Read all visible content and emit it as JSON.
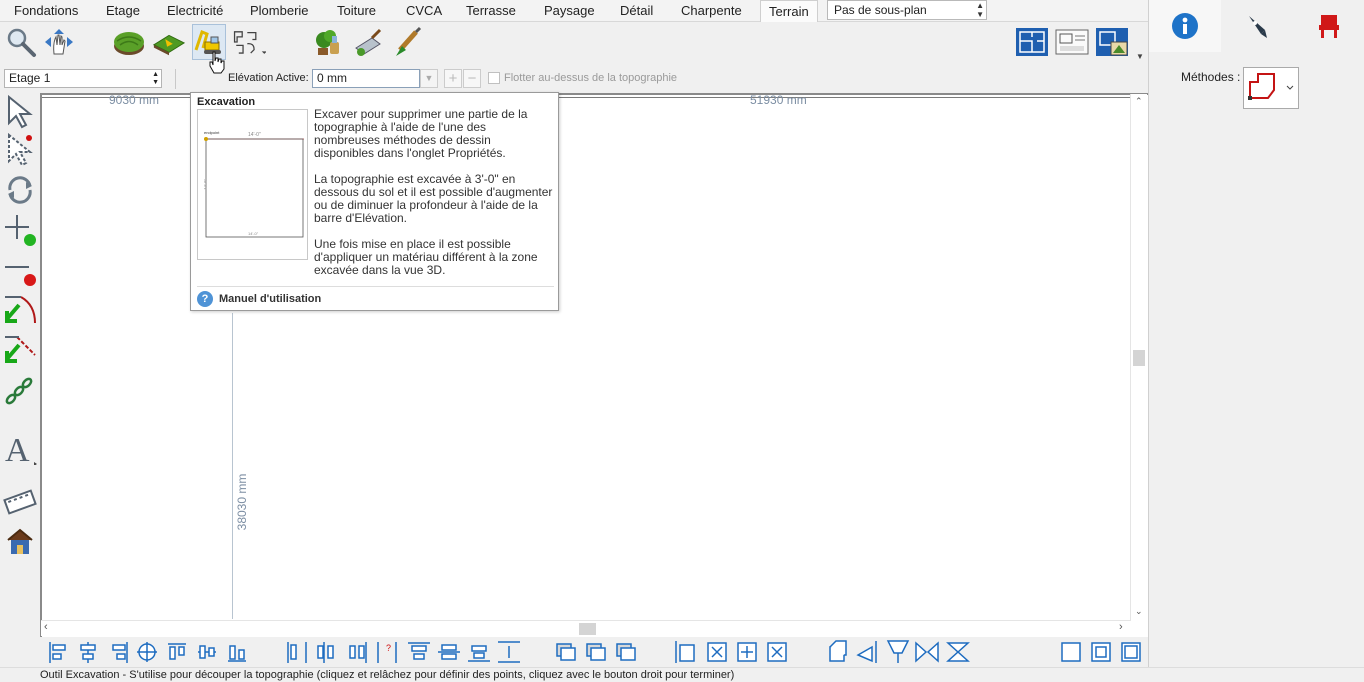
{
  "menu": {
    "tabs": [
      "Fondations",
      "Etage",
      "Electricité",
      "Plomberie",
      "Toiture",
      "CVCA",
      "Terrasse",
      "Paysage",
      "Détail",
      "Charpente",
      "Terrain"
    ],
    "active_tab": "Terrain",
    "subplan_value": "Pas de sous-plan"
  },
  "toolbar": {
    "tools": [
      "zoom-icon",
      "pan-icon",
      "terrain-hill-icon",
      "terrain-flat-icon",
      "excavation-icon",
      "outline-tools-icon",
      "plants-icon",
      "trowel-icon",
      "paint-brush-icon",
      "plan-view-icon",
      "sheet-view-icon",
      "3d-view-icon"
    ],
    "selected_tool": "excavation-icon"
  },
  "floorbar": {
    "floor_value": "Etage 1",
    "elevation_label": "Elévation Active:",
    "elevation_value": "0 mm",
    "float_label": "Flotter au-dessus de la topographie"
  },
  "canvas": {
    "dim_left_top": "9030 mm",
    "dim_right_top": "51930 mm",
    "dim_vertical": "38030 mm"
  },
  "tooltip": {
    "title": "Excavation",
    "para1": "Excaver pour supprimer une partie de la topographie à l'aide de l'une des nombreuses méthodes de dessin disponibles dans l'onglet Propriétés.",
    "para2": "La topographie est excavée à 3'-0\" en dessous du sol et il est possible d'augmenter ou de diminuer la profondeur à l'aide de la barre d'Elévation.",
    "para3": "Une fois mise en place il est possible d'appliquer un matériau différent à la zone excavée dans la vue 3D.",
    "manual_label": "Manuel d'utilisation",
    "thumb_top_label": "14'-0\"",
    "thumb_corner_label": "endpoint",
    "thumb_side_label": "14'-0\"",
    "thumb_bottom_label": "14'-0\""
  },
  "status": {
    "text": "Outil Excavation - S'utilise pour découper la topographie (cliquez et relâchez pour définir des points, cliquez avec le bouton droit pour terminer)"
  },
  "rightpanel": {
    "tabs": [
      "info-icon",
      "pen-icon",
      "chair-icon"
    ],
    "active_tab": "info-icon",
    "methods_label": "Méthodes :"
  },
  "colors": {
    "accent_blue": "#1e73c8",
    "dimension_text": "#7c8ea3",
    "active_tab_bg": "#fbfbfb"
  }
}
